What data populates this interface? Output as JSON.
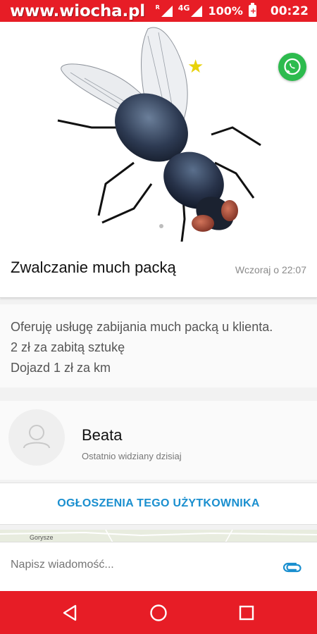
{
  "status_bar": {
    "watermark": "www.wiocha.pl",
    "sim_label": "R",
    "network": "4G",
    "battery": "100%",
    "time": "00:22"
  },
  "listing": {
    "title": "Zwalczanie much packą",
    "date": "Wczoraj o 22:07",
    "description": [
      "Oferuję usługę zabijania much packą u klienta.",
      "2 zł za zabitą sztukę",
      "Dojazd 1 zł za km"
    ]
  },
  "user": {
    "name": "Beata",
    "last_seen": "Ostatnio widziany dzisiaj"
  },
  "user_listings_button": "OGŁOSZENIA TEGO UŻYTKOWNIKA",
  "map": {
    "place_label": "Gorysze"
  },
  "message": {
    "placeholder": "Napisz wiadomość..."
  },
  "colors": {
    "brand_red": "#e71d26",
    "link_blue": "#1a8fcf",
    "whatsapp_green": "#2dbb4e",
    "star_yellow": "#e8d20a"
  },
  "icons": {
    "whatsapp": "whatsapp-icon",
    "favorite": "star-icon",
    "attach": "paperclip-icon",
    "back": "back-triangle-icon",
    "home": "home-circle-icon",
    "recents": "recents-square-icon"
  }
}
